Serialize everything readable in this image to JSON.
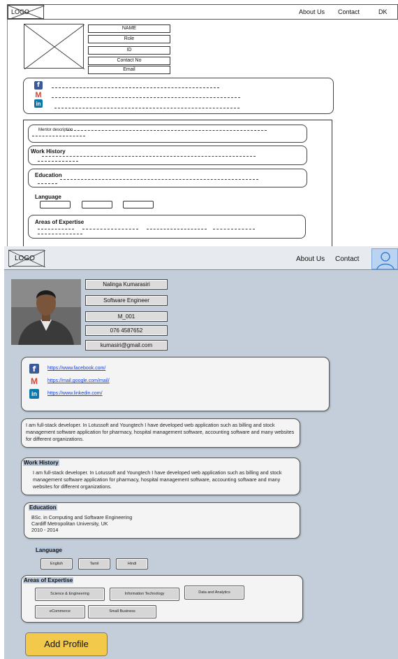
{
  "wireframe": {
    "logo": "LOGO",
    "nav": [
      "About Us",
      "Contact",
      "DK"
    ],
    "fields": [
      "NAME",
      "Role",
      "ID",
      "Contact No",
      "Email"
    ],
    "mentor_description": "Mentor description",
    "work_history": "Work History",
    "education": "Education",
    "language": "Language",
    "areas_of_expertise": "Areas of Expertise"
  },
  "mockup": {
    "logo": "LOGO",
    "nav": [
      "About Us",
      "Contact"
    ],
    "name": "Nalinga Kumarasiri",
    "role": "Software Engineer",
    "id": "M_001",
    "contact_no": "076 4587652",
    "email": "kumasiri@gmail.com",
    "social": {
      "facebook": "https://www.facebook.com/",
      "gmail": "https://mail.google.com/mail/",
      "linkedin": "https://www.linkedin.com/"
    },
    "description": "I am full-stack developer. In Lotussoft and Youngtech I have developed web application such as billing and stock management software application for pharmacy, hospital management software, accounting software and many websites for different organizations.",
    "work_history": {
      "title": "Work History",
      "text": "I am full-stack developer. In Lotussoft and Youngtech I have developed web application such as billing and stock management software application for pharmacy, hospital management software, accounting software and many websites for different organizations."
    },
    "education": {
      "title": "Education",
      "degree": "BSc. in Computing and Software Engineering",
      "university": "Cardiff Metropolitan University, UK",
      "years": "2010 - 2014"
    },
    "language": {
      "title": "Language",
      "items": [
        "English",
        "Tamil",
        "Hindi"
      ]
    },
    "expertise": {
      "title": "Areas of Expertise",
      "items": [
        "Science & Engineering",
        "Information Technology",
        "Data and Analytics",
        "eCommerce",
        "Small Business"
      ]
    },
    "add_button": "Add Profile"
  },
  "colors": {
    "mock_bg": "#c3ceda",
    "add_button": "#f2c94a",
    "facebook": "#3b5998",
    "linkedin": "#0e76a8",
    "gmail": "#d44638"
  }
}
